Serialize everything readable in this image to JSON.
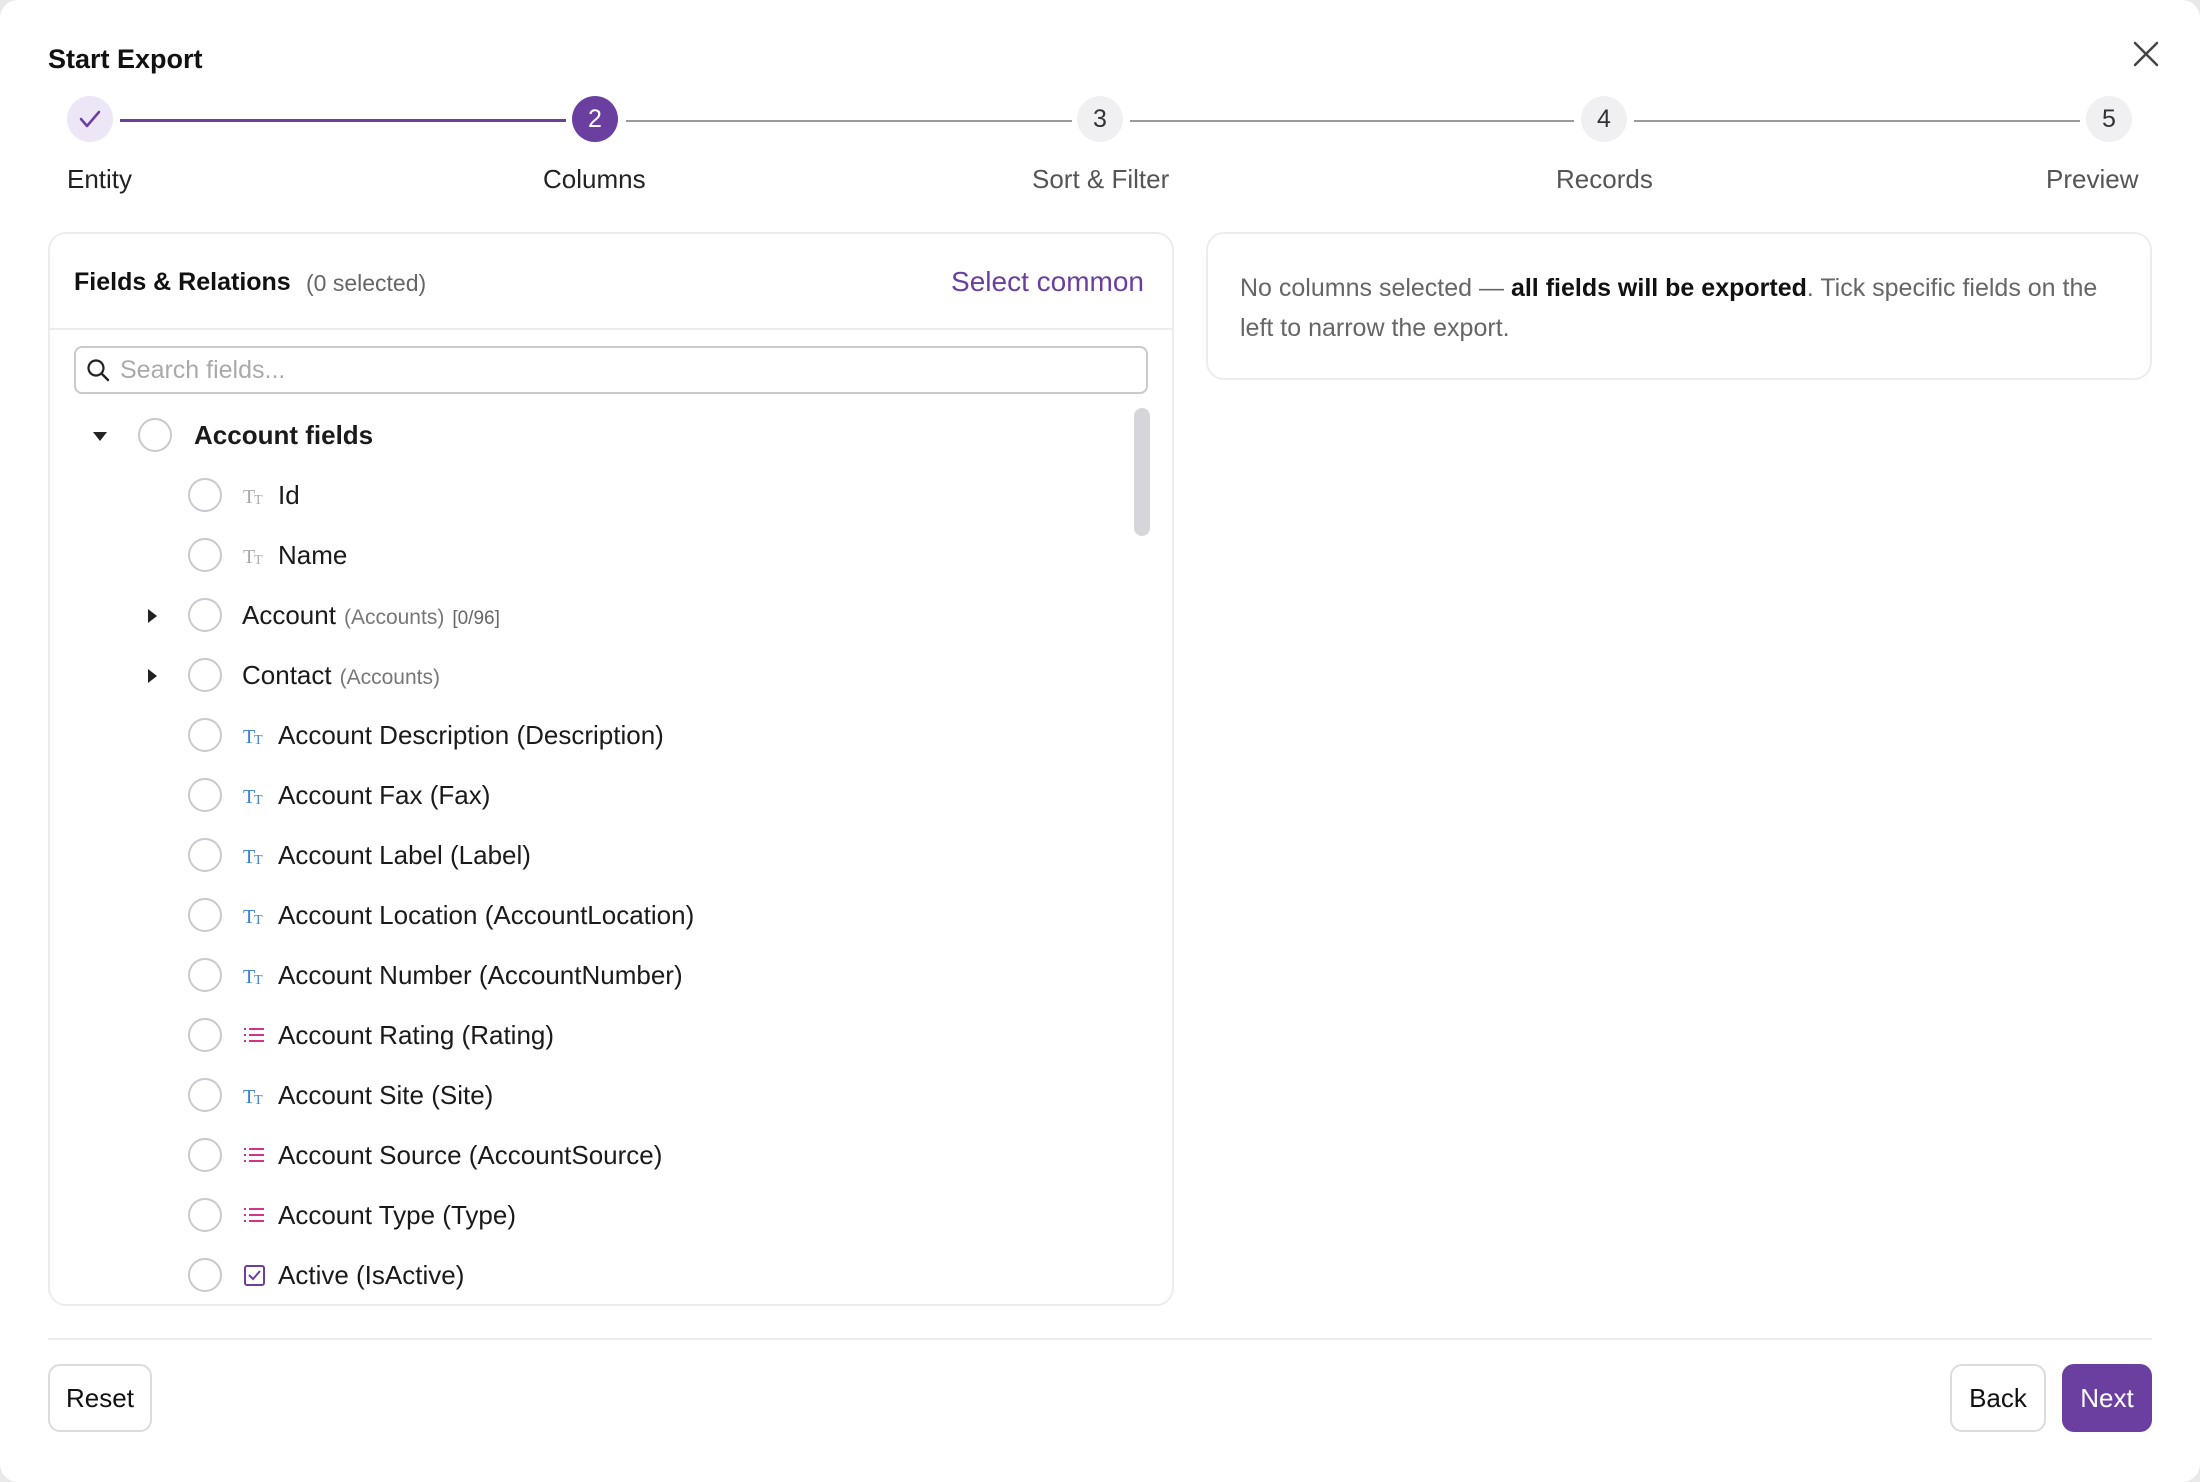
{
  "dialog": {
    "title": "Start Export"
  },
  "stepper": {
    "steps": [
      {
        "number": "",
        "label": "Entity",
        "state": "done"
      },
      {
        "number": "2",
        "label": "Columns",
        "state": "active"
      },
      {
        "number": "3",
        "label": "Sort & Filter",
        "state": "pending"
      },
      {
        "number": "4",
        "label": "Records",
        "state": "pending"
      },
      {
        "number": "5",
        "label": "Preview",
        "state": "pending"
      }
    ]
  },
  "fields_panel": {
    "title": "Fields & Relations",
    "selected_count": "(0 selected)",
    "select_common_label": "Select common",
    "search_placeholder": "Search fields...",
    "search_value": "",
    "group_label": "Account fields",
    "rows": [
      {
        "label": "Id",
        "icon": "text-type-icon"
      },
      {
        "label": "Name",
        "icon": "text-type-icon"
      },
      {
        "label": "Account",
        "meta": "(Accounts)",
        "count": "[0/96]",
        "icon": "relation",
        "expandable": true
      },
      {
        "label": "Contact",
        "meta": "(Accounts)",
        "count": "",
        "icon": "relation",
        "expandable": true
      },
      {
        "label": "Account Description (Description)",
        "icon": "text-type-icon"
      },
      {
        "label": "Account Fax (Fax)",
        "icon": "text-type-icon"
      },
      {
        "label": "Account Label (Label)",
        "icon": "text-type-icon"
      },
      {
        "label": "Account Location (AccountLocation)",
        "icon": "text-type-icon"
      },
      {
        "label": "Account Number (AccountNumber)",
        "icon": "text-type-icon"
      },
      {
        "label": "Account Rating (Rating)",
        "icon": "picklist-icon"
      },
      {
        "label": "Account Site (Site)",
        "icon": "text-type-icon"
      },
      {
        "label": "Account Source (AccountSource)",
        "icon": "picklist-icon"
      },
      {
        "label": "Account Type (Type)",
        "icon": "picklist-icon"
      },
      {
        "label": "Active (IsActive)",
        "icon": "checkbox-type-icon"
      }
    ]
  },
  "summary_panel": {
    "text_before": "No columns selected — ",
    "text_bold": "all fields will be exported",
    "text_after": ". Tick specific fields on the left to narrow the export."
  },
  "footer": {
    "reset_label": "Reset",
    "back_label": "Back",
    "next_label": "Next"
  },
  "colors": {
    "accent": "#6b3fa0",
    "text_icon_blue": "#3b82d6",
    "picklist_pink": "#d63384"
  }
}
